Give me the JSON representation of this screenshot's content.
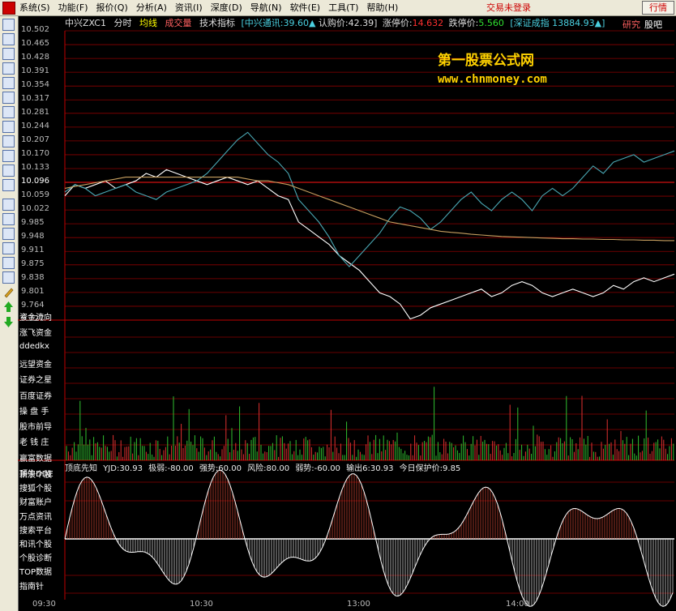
{
  "menubar": {
    "items": [
      "系统(S)",
      "功能(F)",
      "报价(Q)",
      "分析(A)",
      "资讯(I)",
      "深度(D)",
      "导航(N)",
      "软件(E)",
      "工具(T)",
      "帮助(H)"
    ],
    "trade_login": "交易未登录",
    "quote_button": "行情"
  },
  "infobar": {
    "code": "中兴ZXC1",
    "mode": "分时",
    "avg_line": "均线",
    "volume": "成交量",
    "tech": "技术指标",
    "ref": "[中兴通讯:39.60▲",
    "subscribe": "认购价:42.39]",
    "limit_up_label": "涨停价:",
    "limit_up": "14.632",
    "limit_down_label": "跌停价:",
    "limit_down": "5.560",
    "index": "[深证成指 13884.93▲]",
    "research": "研究",
    "forum": "股吧"
  },
  "y_axis": [
    "10.502",
    "10.465",
    "10.428",
    "10.391",
    "10.354",
    "10.317",
    "10.281",
    "10.244",
    "10.207",
    "10.170",
    "10.133",
    "10.096",
    "10.059",
    "10.022",
    "9.985",
    "9.948",
    "9.911",
    "9.875",
    "9.838",
    "9.801",
    "9.764",
    "9.727"
  ],
  "side_tabs": [
    "资金流向",
    "涨飞资金",
    "ddedkx",
    "远望资金",
    "证券之星",
    "百度证券",
    "操 盘 手",
    "股市前导",
    "老 钱 庄",
    "赢富数据",
    "顶牛DDE",
    "新浪个股",
    "搜狐个股",
    "财富账户",
    "万点资讯",
    "搜索平台",
    "和讯个股",
    "个股诊断",
    "TOP数据",
    "指南针"
  ],
  "indicator": {
    "name": "顶底先知",
    "yjd": "YJD:30.93",
    "weak_extreme": "极弱:-80.00",
    "strong": "强势:60.00",
    "risk": "风险:80.00",
    "weak": "弱势:-60.00",
    "output": "输出6:30.93",
    "protect": "今日保护价:9.85"
  },
  "time_labels": [
    "09:30",
    "10:30",
    "13:00",
    "14:00"
  ],
  "watermark": {
    "title": "第一股票公式网",
    "url": "www.chnmoney.com"
  },
  "colors": {
    "price": "#ffffff",
    "ref_line": "#4aa8b4",
    "avg_line": "#c8a060",
    "grid": "#8b0000",
    "accent": "#ffd200"
  },
  "chart_data": {
    "type": "line",
    "ylim": [
      9.727,
      10.502
    ],
    "series": [
      {
        "name": "中兴ZXC1",
        "values": [
          10.06,
          10.09,
          10.08,
          10.09,
          10.1,
          10.08,
          10.09,
          10.1,
          10.12,
          10.11,
          10.13,
          10.12,
          10.11,
          10.1,
          10.09,
          10.1,
          10.11,
          10.1,
          10.09,
          10.1,
          10.08,
          10.06,
          10.05,
          9.99,
          9.97,
          9.95,
          9.93,
          9.9,
          9.88,
          9.86,
          9.83,
          9.8,
          9.79,
          9.77,
          9.73,
          9.74,
          9.76,
          9.77,
          9.78,
          9.79,
          9.8,
          9.81,
          9.79,
          9.8,
          9.82,
          9.83,
          9.82,
          9.8,
          9.79,
          9.8,
          9.81,
          9.8,
          9.79,
          9.8,
          9.82,
          9.81,
          9.83,
          9.84,
          9.83,
          9.84,
          9.85
        ]
      },
      {
        "name": "中兴通讯",
        "values": [
          10.07,
          10.09,
          10.08,
          10.06,
          10.07,
          10.08,
          10.09,
          10.07,
          10.06,
          10.05,
          10.07,
          10.08,
          10.09,
          10.1,
          10.12,
          10.15,
          10.18,
          10.21,
          10.23,
          10.2,
          10.17,
          10.15,
          10.12,
          10.05,
          10.02,
          9.99,
          9.95,
          9.9,
          9.87,
          9.9,
          9.93,
          9.96,
          10.0,
          10.03,
          10.02,
          10.0,
          9.97,
          9.99,
          10.02,
          10.05,
          10.07,
          10.04,
          10.02,
          10.05,
          10.07,
          10.05,
          10.02,
          10.06,
          10.08,
          10.06,
          10.08,
          10.11,
          10.14,
          10.12,
          10.15,
          10.16,
          10.17,
          10.15,
          10.16,
          10.17,
          10.18
        ]
      },
      {
        "name": "均线",
        "values": [
          10.08,
          10.085,
          10.09,
          10.095,
          10.1,
          10.105,
          10.11,
          10.11,
          10.11,
          10.11,
          10.11,
          10.11,
          10.11,
          10.11,
          10.11,
          10.11,
          10.11,
          10.11,
          10.105,
          10.1,
          10.1,
          10.095,
          10.09,
          10.08,
          10.07,
          10.06,
          10.05,
          10.04,
          10.03,
          10.02,
          10.01,
          10.0,
          9.99,
          9.985,
          9.98,
          9.975,
          9.97,
          9.965,
          9.962,
          9.96,
          9.957,
          9.955,
          9.953,
          9.951,
          9.95,
          9.949,
          9.948,
          9.947,
          9.946,
          9.945,
          9.945,
          9.944,
          9.944,
          9.943,
          9.943,
          9.942,
          9.942,
          9.941,
          9.941,
          9.94,
          9.94
        ]
      }
    ]
  }
}
